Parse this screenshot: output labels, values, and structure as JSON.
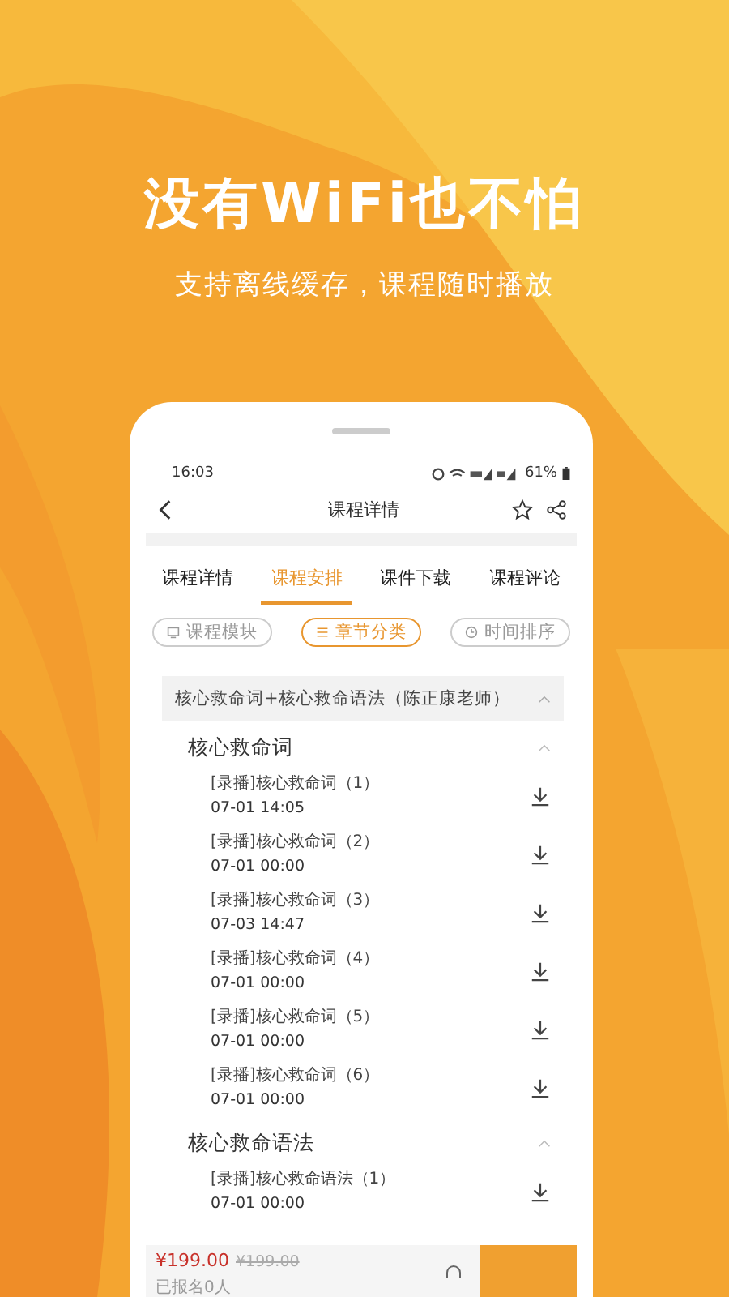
{
  "headline": "没有WiFi也不怕",
  "subtitle": "支持离线缓存，课程随时播放",
  "status_bar": {
    "time": "16:03",
    "battery": "61%"
  },
  "nav": {
    "title": "课程详情",
    "favorited": false
  },
  "tabs": [
    {
      "label": "课程详情",
      "selected": false
    },
    {
      "label": "课程安排",
      "selected": true
    },
    {
      "label": "课件下载",
      "selected": false
    },
    {
      "label": "课程评论",
      "selected": false
    }
  ],
  "filters": [
    {
      "label": "课程模块",
      "selected": false,
      "kind": "module"
    },
    {
      "label": "章节分类",
      "selected": true,
      "kind": "chapter"
    },
    {
      "label": "时间排序",
      "selected": false,
      "kind": "time"
    }
  ],
  "course": {
    "title": "核心救命词+核心救命语法（陈正康老师）",
    "expanded": true,
    "chapters": [
      {
        "title": "核心救命词",
        "expanded": true,
        "lessons": [
          {
            "title": "[录播]核心救命词（1）",
            "time": "07-01 14:05"
          },
          {
            "title": "[录播]核心救命词（2）",
            "time": "07-01 00:00"
          },
          {
            "title": "[录播]核心救命词（3）",
            "time": "07-03 14:47"
          },
          {
            "title": "[录播]核心救命词（4）",
            "time": "07-01 00:00"
          },
          {
            "title": "[录播]核心救命词（5）",
            "time": "07-01 00:00"
          },
          {
            "title": "[录播]核心救命词（6）",
            "time": "07-01 00:00"
          }
        ]
      },
      {
        "title": "核心救命语法",
        "expanded": true,
        "lessons": [
          {
            "title": "[录播]核心救命语法（1）",
            "time": "07-01 00:00"
          }
        ]
      }
    ]
  },
  "bottom_bar": {
    "price": "¥199.00",
    "original_price": "¥199.00",
    "enrolled": "已报名0人"
  }
}
